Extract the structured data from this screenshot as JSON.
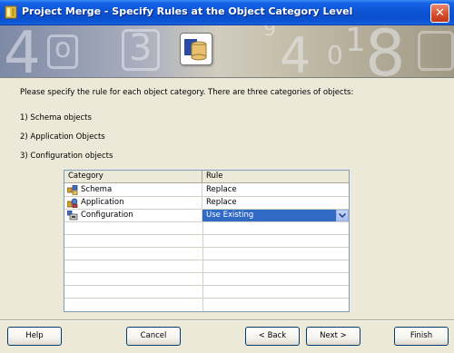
{
  "window": {
    "title": "Project Merge - Specify Rules at the Object Category Level",
    "close_label": "✕"
  },
  "banner": {
    "numbers": [
      "4",
      "3",
      "9",
      "1",
      "0",
      "8",
      "4",
      "o"
    ]
  },
  "content": {
    "intro": "Please specify the rule for each object category. There are three categories of objects:",
    "categories": [
      "1) Schema objects",
      "2) Application Objects",
      "3) Configuration objects"
    ]
  },
  "grid": {
    "headers": {
      "category": "Category",
      "rule": "Rule"
    },
    "rows": [
      {
        "category": "Schema",
        "rule": "Replace",
        "icon": "schema-icon"
      },
      {
        "category": "Application",
        "rule": "Replace",
        "icon": "application-icon"
      },
      {
        "category": "Configuration",
        "rule": "Use Existing",
        "icon": "configuration-icon"
      }
    ]
  },
  "buttons": {
    "help": "Help",
    "cancel": "Cancel",
    "back": "< Back",
    "next": "Next >",
    "finish": "Finish"
  },
  "colors": {
    "titlebar": "#0a4fce",
    "selection": "#316ac5",
    "close": "#d9532f"
  }
}
